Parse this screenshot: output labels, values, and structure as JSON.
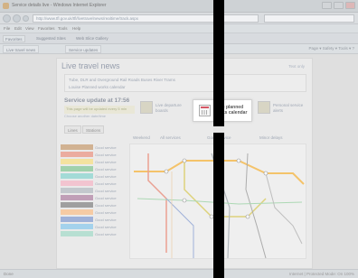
{
  "window": {
    "title": "Service details live - Windows Internet Explorer"
  },
  "nav": {
    "address": "http://www.tfl.gov.uk/tfl/livetravelnews/realtime/track.aspx"
  },
  "menu": [
    "File",
    "Edit",
    "View",
    "Favorites",
    "Tools",
    "Help"
  ],
  "toolbar": {
    "items": [
      "Favorites",
      "Suggested Sites",
      "Web Slice Gallery"
    ]
  },
  "tabs": [
    "Live travel news",
    "Service updates"
  ],
  "fav_right": "Page ▾  Safety ▾  Tools ▾  ?",
  "page": {
    "title": "Live travel news",
    "right_link": "Text only",
    "filter_line1": "Tube, DLR and Overground   Rail   Roads   Buses   River   Trams",
    "filter_line2": "Louise   Planned works calendar",
    "service_heading": "Service update at 17:56",
    "service_sub": "This page will be updated every 5 min",
    "service_sub2": "Choose another date/time",
    "promo1": "Live departure boards",
    "promo2": "Personal service alerts",
    "highlight": "Tube planned works calendar",
    "view_tabs": [
      "Lines",
      "Stations"
    ],
    "map_filters": [
      "Weekend",
      "All services",
      "Good service",
      "Minor delays"
    ],
    "lines": [
      {
        "name": "Bakerloo",
        "color": "#c7a27a",
        "status": "Good service"
      },
      {
        "name": "Central",
        "color": "#e79a8a",
        "status": "Good service"
      },
      {
        "name": "Circle",
        "color": "#f2dc8a",
        "status": "Good service"
      },
      {
        "name": "District",
        "color": "#8dc79a",
        "status": "Good service"
      },
      {
        "name": "DLR",
        "color": "#8fd3cf",
        "status": "Good service"
      },
      {
        "name": "H&C",
        "color": "#f0b8c6",
        "status": "Good service"
      },
      {
        "name": "Jubilee",
        "color": "#b6bcc2",
        "status": "Good service"
      },
      {
        "name": "Metropolitan",
        "color": "#b28aa8",
        "status": "Good service"
      },
      {
        "name": "Northern",
        "color": "#8a8a8a",
        "status": "Good service"
      },
      {
        "name": "Overground",
        "color": "#f4c090",
        "status": "Good service"
      },
      {
        "name": "Piccadilly",
        "color": "#8aa0d0",
        "status": "Good service"
      },
      {
        "name": "Victoria",
        "color": "#90c8e8",
        "status": "Good service"
      },
      {
        "name": "Waterloo & City",
        "color": "#a8d8c8",
        "status": "Good service"
      }
    ]
  },
  "status_bar": {
    "left": "Done",
    "right": "Internet | Protected Mode: On   100%"
  }
}
